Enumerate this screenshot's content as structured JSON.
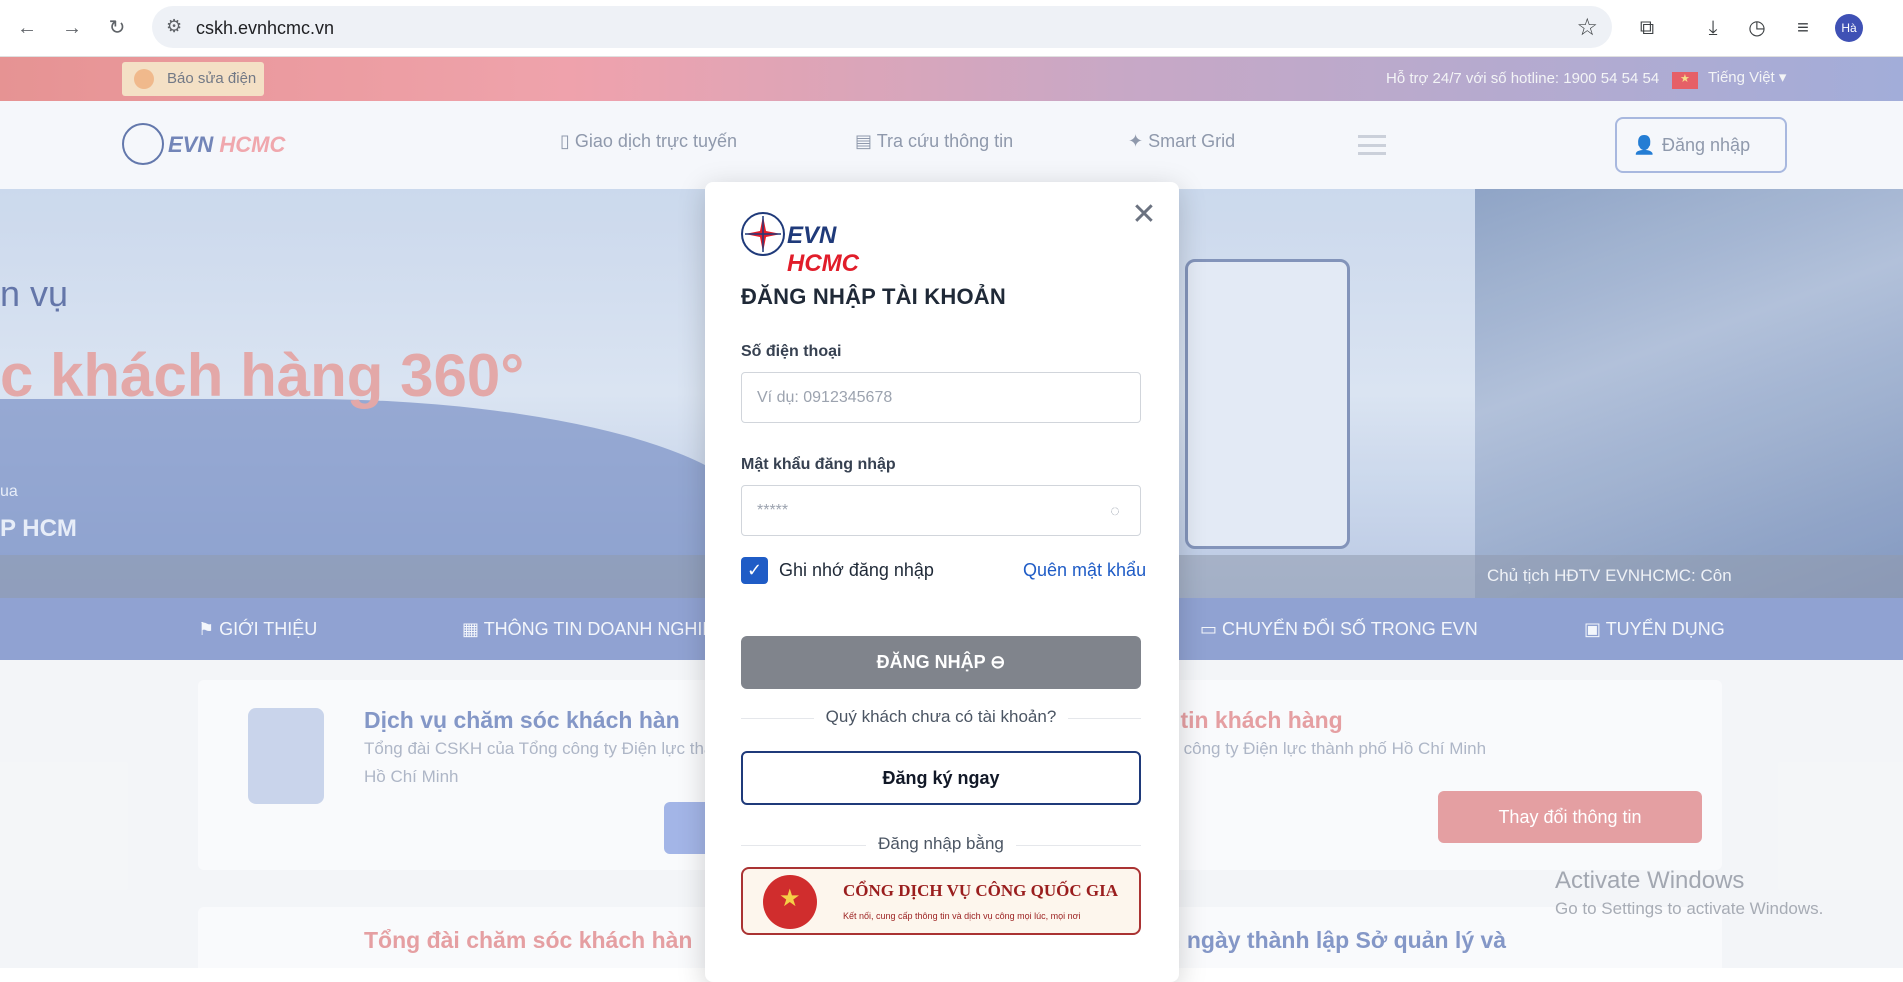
{
  "browser": {
    "url": "cskh.evnhcmc.vn",
    "avatar": "Hà",
    "icons": [
      "back-icon",
      "forward-icon",
      "reload-icon",
      "site-info-icon",
      "bookmark-star-icon",
      "extensions-icon",
      "download-icon",
      "performance-icon",
      "media-control-icon"
    ]
  },
  "topbar": {
    "report_label": "Báo sửa điện",
    "hotline": "Hỗ trợ 24/7 với số hotline: 1900 54 54 54",
    "language": "Tiếng Việt ▾"
  },
  "header": {
    "logo_evn": "EVN",
    "logo_hcmc": "HCMC",
    "nav": [
      "Giao dịch trực tuyến",
      "Tra cứu thông tin",
      "Smart Grid"
    ],
    "login": "Đăng nhập"
  },
  "hero": {
    "line1": "n vụ",
    "line2": "c khách hàng 360°",
    "line3": "ua",
    "line4": "P HCM",
    "caption": "Chủ tịch HĐTV EVNHCMC: Côn"
  },
  "menu": [
    "GIỚI THIỆU",
    "THÔNG TIN DOANH NGHIỆP",
    "CHUYỂN ĐỔI SỐ TRONG EVN",
    "TUYỂN DỤNG"
  ],
  "cards": {
    "c1_title": "Dịch vụ chăm sóc khách hàn",
    "c1_sub1": "Tổng đài CSKH của Tổng công ty Điện lực tha",
    "c1_sub2": "Hồ Chí Minh",
    "c2_title": "g tin khách hàng",
    "c2_sub": "ng công ty Điện lực thành phố Hồ Chí Minh",
    "c2_button": "Thay đổi thông tin",
    "c3_title": "Tổng đài chăm sóc khách hàn",
    "c4_title": "m ngày thành lập Sở quản lý và"
  },
  "watermark": {
    "line1": "Activate Windows",
    "line2": "Go to Settings to activate Windows."
  },
  "modal": {
    "logo_evn": "EVN",
    "logo_hcmc": "HCMC",
    "title": "ĐĂNG NHẬP TÀI KHOẢN",
    "phone_label": "Số điện thoại",
    "phone_placeholder": "Ví dụ: 0912345678",
    "password_label": "Mật khẩu đăng nhập",
    "password_placeholder": "*****",
    "remember": "Ghi nhớ đăng nhập",
    "forgot": "Quên mật khẩu",
    "submit": "ĐĂNG NHẬP ⊖",
    "no_account": "Quý khách chưa có tài khoản?",
    "register": "Đăng ký ngay",
    "login_with": "Đăng nhập bằng",
    "gov_title": "CỔNG DỊCH VỤ CÔNG QUỐC GIA",
    "gov_sub": "Kết nối, cung cấp thông tin và dịch vụ công mọi lúc, mọi nơi"
  }
}
